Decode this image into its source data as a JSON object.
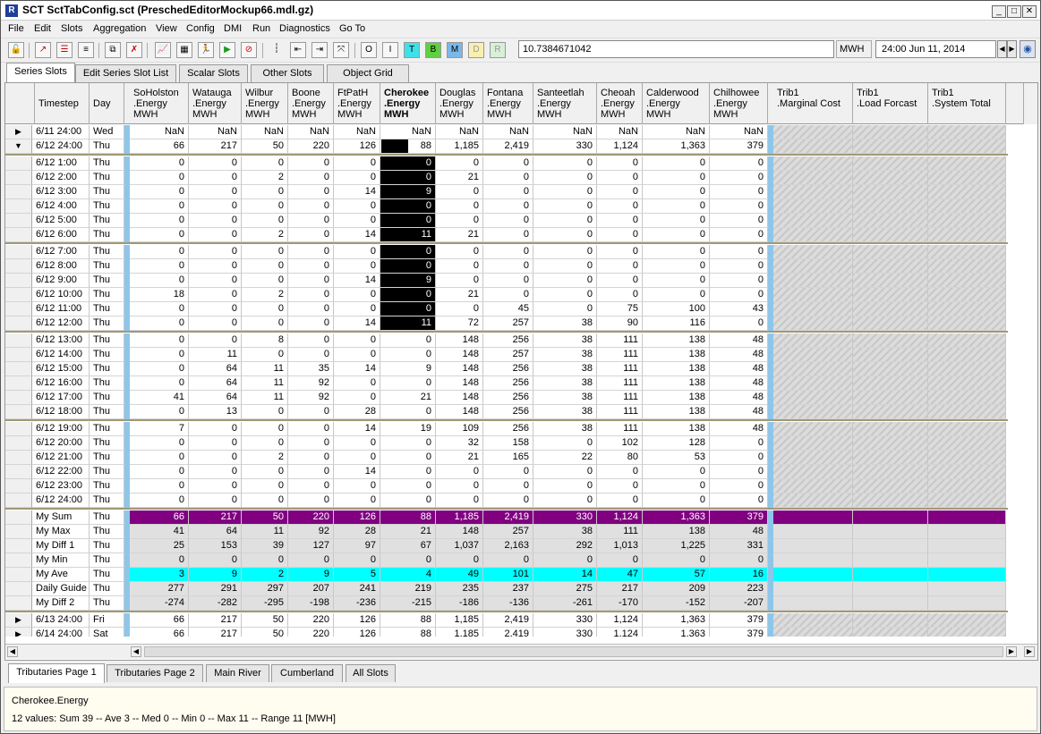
{
  "window": {
    "title": "SCT SctTabConfig.sct (PreschedEditorMockup66.mdl.gz)",
    "app_icon": "rw-logo-icon"
  },
  "menu": [
    "File",
    "Edit",
    "Slots",
    "Aggregation",
    "View",
    "Config",
    "DMI",
    "Run",
    "Diagnostics",
    "Go To"
  ],
  "toolbar": {
    "value": "10.7384671042",
    "units": "MWH",
    "datetime": "24:00 Jun 11, 2014"
  },
  "top_tabs": [
    "Series Slots",
    "Edit Series Slot List",
    "Scalar Slots",
    "Other Slots",
    "Object Grid"
  ],
  "bottom_tabs": [
    "Tributaries Page 1",
    "Tributaries Page 2",
    "Main River",
    "Cumberland",
    "All Slots"
  ],
  "columns": {
    "timestep": "Timestep",
    "day": "Day",
    "slots": [
      [
        "SoHolston",
        ".Energy",
        "MWH"
      ],
      [
        "Watauga",
        ".Energy",
        "MWH"
      ],
      [
        "Wilbur",
        ".Energy",
        "MWH"
      ],
      [
        "Boone",
        ".Energy",
        "MWH"
      ],
      [
        "FtPatH",
        ".Energy",
        "MWH"
      ],
      [
        "Cherokee",
        ".Energy",
        "MWH"
      ],
      [
        "Douglas",
        ".Energy",
        "MWH"
      ],
      [
        "Fontana",
        ".Energy",
        "MWH"
      ],
      [
        "Santeetlah",
        ".Energy",
        "MWH"
      ],
      [
        "Cheoah",
        ".Energy",
        "MWH"
      ],
      [
        "Calderwood",
        ".Energy",
        "MWH"
      ],
      [
        "Chilhowee",
        ".Energy",
        "MWH"
      ]
    ],
    "trib": [
      [
        "Trib1",
        ".Marginal Cost"
      ],
      [
        "Trib1",
        ".Load Forcast"
      ],
      [
        "Trib1",
        ".System Total"
      ]
    ]
  },
  "rows": [
    {
      "m": "▶",
      "t": "6/11 24:00",
      "d": "Wed",
      "v": [
        "NaN",
        "NaN",
        "NaN",
        "NaN",
        "NaN",
        "NaN",
        "NaN",
        "NaN",
        "NaN",
        "NaN",
        "NaN",
        "NaN"
      ]
    },
    {
      "m": "▼",
      "t": "6/12 24:00",
      "d": "Thu",
      "v": [
        "66",
        "217",
        "50",
        "220",
        "126",
        "88",
        "1,185",
        "2,419",
        "330",
        "1,124",
        "1,363",
        "379"
      ]
    },
    {
      "t": "6/12 1:00",
      "d": "Thu",
      "v": [
        "0",
        "0",
        "0",
        "0",
        "0",
        "0",
        "0",
        "0",
        "0",
        "0",
        "0",
        "0"
      ]
    },
    {
      "t": "6/12 2:00",
      "d": "Thu",
      "v": [
        "0",
        "0",
        "2",
        "0",
        "0",
        "0",
        "21",
        "0",
        "0",
        "0",
        "0",
        "0"
      ]
    },
    {
      "t": "6/12 3:00",
      "d": "Thu",
      "v": [
        "0",
        "0",
        "0",
        "0",
        "14",
        "9",
        "0",
        "0",
        "0",
        "0",
        "0",
        "0"
      ]
    },
    {
      "t": "6/12 4:00",
      "d": "Thu",
      "v": [
        "0",
        "0",
        "0",
        "0",
        "0",
        "0",
        "0",
        "0",
        "0",
        "0",
        "0",
        "0"
      ]
    },
    {
      "t": "6/12 5:00",
      "d": "Thu",
      "v": [
        "0",
        "0",
        "0",
        "0",
        "0",
        "0",
        "0",
        "0",
        "0",
        "0",
        "0",
        "0"
      ]
    },
    {
      "t": "6/12 6:00",
      "d": "Thu",
      "v": [
        "0",
        "0",
        "2",
        "0",
        "14",
        "11",
        "21",
        "0",
        "0",
        "0",
        "0",
        "0"
      ]
    },
    {
      "t": "6/12 7:00",
      "d": "Thu",
      "v": [
        "0",
        "0",
        "0",
        "0",
        "0",
        "0",
        "0",
        "0",
        "0",
        "0",
        "0",
        "0"
      ]
    },
    {
      "t": "6/12 8:00",
      "d": "Thu",
      "v": [
        "0",
        "0",
        "0",
        "0",
        "0",
        "0",
        "0",
        "0",
        "0",
        "0",
        "0",
        "0"
      ]
    },
    {
      "t": "6/12 9:00",
      "d": "Thu",
      "v": [
        "0",
        "0",
        "0",
        "0",
        "14",
        "9",
        "0",
        "0",
        "0",
        "0",
        "0",
        "0"
      ]
    },
    {
      "t": "6/12 10:00",
      "d": "Thu",
      "v": [
        "18",
        "0",
        "2",
        "0",
        "0",
        "0",
        "21",
        "0",
        "0",
        "0",
        "0",
        "0"
      ]
    },
    {
      "t": "6/12 11:00",
      "d": "Thu",
      "v": [
        "0",
        "0",
        "0",
        "0",
        "0",
        "0",
        "0",
        "45",
        "0",
        "75",
        "100",
        "43"
      ]
    },
    {
      "t": "6/12 12:00",
      "d": "Thu",
      "v": [
        "0",
        "0",
        "0",
        "0",
        "14",
        "11",
        "72",
        "257",
        "38",
        "90",
        "116",
        "0"
      ]
    },
    {
      "t": "6/12 13:00",
      "d": "Thu",
      "v": [
        "0",
        "0",
        "8",
        "0",
        "0",
        "0",
        "148",
        "256",
        "38",
        "111",
        "138",
        "48"
      ]
    },
    {
      "t": "6/12 14:00",
      "d": "Thu",
      "v": [
        "0",
        "11",
        "0",
        "0",
        "0",
        "0",
        "148",
        "257",
        "38",
        "111",
        "138",
        "48"
      ]
    },
    {
      "t": "6/12 15:00",
      "d": "Thu",
      "v": [
        "0",
        "64",
        "11",
        "35",
        "14",
        "9",
        "148",
        "256",
        "38",
        "111",
        "138",
        "48"
      ]
    },
    {
      "t": "6/12 16:00",
      "d": "Thu",
      "v": [
        "0",
        "64",
        "11",
        "92",
        "0",
        "0",
        "148",
        "256",
        "38",
        "111",
        "138",
        "48"
      ]
    },
    {
      "t": "6/12 17:00",
      "d": "Thu",
      "v": [
        "41",
        "64",
        "11",
        "92",
        "0",
        "21",
        "148",
        "256",
        "38",
        "111",
        "138",
        "48"
      ]
    },
    {
      "t": "6/12 18:00",
      "d": "Thu",
      "v": [
        "0",
        "13",
        "0",
        "0",
        "28",
        "0",
        "148",
        "256",
        "38",
        "111",
        "138",
        "48"
      ]
    },
    {
      "t": "6/12 19:00",
      "d": "Thu",
      "v": [
        "7",
        "0",
        "0",
        "0",
        "14",
        "19",
        "109",
        "256",
        "38",
        "111",
        "138",
        "48"
      ]
    },
    {
      "t": "6/12 20:00",
      "d": "Thu",
      "v": [
        "0",
        "0",
        "0",
        "0",
        "0",
        "0",
        "32",
        "158",
        "0",
        "102",
        "128",
        "0"
      ]
    },
    {
      "t": "6/12 21:00",
      "d": "Thu",
      "v": [
        "0",
        "0",
        "2",
        "0",
        "0",
        "0",
        "21",
        "165",
        "22",
        "80",
        "53",
        "0"
      ]
    },
    {
      "t": "6/12 22:00",
      "d": "Thu",
      "v": [
        "0",
        "0",
        "0",
        "0",
        "14",
        "0",
        "0",
        "0",
        "0",
        "0",
        "0",
        "0"
      ]
    },
    {
      "t": "6/12 23:00",
      "d": "Thu",
      "v": [
        "0",
        "0",
        "0",
        "0",
        "0",
        "0",
        "0",
        "0",
        "0",
        "0",
        "0",
        "0"
      ]
    },
    {
      "t": "6/12 24:00",
      "d": "Thu",
      "v": [
        "0",
        "0",
        "0",
        "0",
        "0",
        "0",
        "0",
        "0",
        "0",
        "0",
        "0",
        "0"
      ]
    },
    {
      "t": "My Sum",
      "d": "Thu",
      "v": [
        "66",
        "217",
        "50",
        "220",
        "126",
        "88",
        "1,185",
        "2,419",
        "330",
        "1,124",
        "1,363",
        "379"
      ]
    },
    {
      "t": "My Max",
      "d": "Thu",
      "v": [
        "41",
        "64",
        "11",
        "92",
        "28",
        "21",
        "148",
        "257",
        "38",
        "111",
        "138",
        "48"
      ]
    },
    {
      "t": "My Diff 1",
      "d": "Thu",
      "v": [
        "25",
        "153",
        "39",
        "127",
        "97",
        "67",
        "1,037",
        "2,163",
        "292",
        "1,013",
        "1,225",
        "331"
      ]
    },
    {
      "t": "My Min",
      "d": "Thu",
      "v": [
        "0",
        "0",
        "0",
        "0",
        "0",
        "0",
        "0",
        "0",
        "0",
        "0",
        "0",
        "0"
      ]
    },
    {
      "t": "My Ave",
      "d": "Thu",
      "v": [
        "3",
        "9",
        "2",
        "9",
        "5",
        "4",
        "49",
        "101",
        "14",
        "47",
        "57",
        "16"
      ]
    },
    {
      "t": "Daily Guide",
      "d": "Thu",
      "v": [
        "277",
        "291",
        "297",
        "207",
        "241",
        "219",
        "235",
        "237",
        "275",
        "217",
        "209",
        "223"
      ]
    },
    {
      "t": "My Diff 2",
      "d": "Thu",
      "v": [
        "-274",
        "-282",
        "-295",
        "-198",
        "-236",
        "-215",
        "-186",
        "-136",
        "-261",
        "-170",
        "-152",
        "-207"
      ]
    },
    {
      "m": "▶",
      "t": "6/13 24:00",
      "d": "Fri",
      "v": [
        "66",
        "217",
        "50",
        "220",
        "126",
        "88",
        "1,185",
        "2,419",
        "330",
        "1,124",
        "1,363",
        "379"
      ]
    },
    {
      "m": "▶",
      "t": "6/14 24:00",
      "d": "Sat",
      "v": [
        "66",
        "217",
        "50",
        "220",
        "126",
        "88",
        "1,185",
        "2,419",
        "330",
        "1,124",
        "1,363",
        "379"
      ]
    }
  ],
  "colors": {
    "sum_row": "#800080",
    "ave_row": "#00ffff",
    "stat_row": "#e0e0e0",
    "selected_col": "#000000"
  },
  "status": {
    "slot": "Cherokee.Energy",
    "stats": "12 values:  Sum 39 -- Ave 3 -- Med 0 -- Min 0 -- Max 11 -- Range 11 [MWH]"
  }
}
